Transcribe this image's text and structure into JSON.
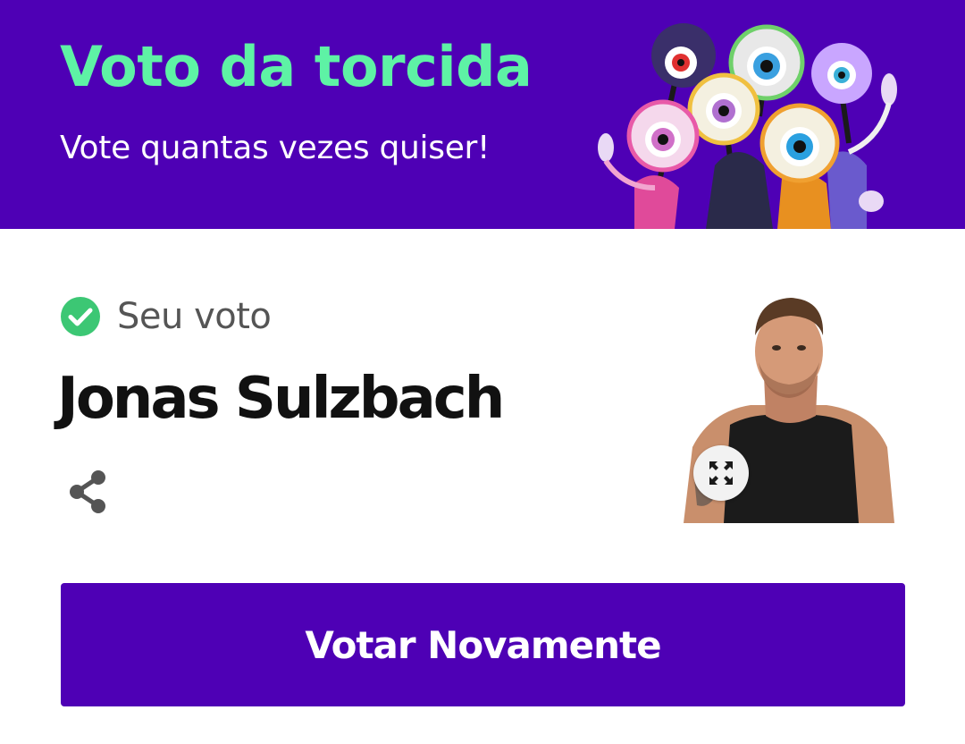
{
  "banner": {
    "title": "Voto da torcida",
    "subtitle": "Vote quantas vezes quiser!",
    "background_color": "#4e00b5",
    "title_color": "#5ef2a5",
    "mascots_icon": "bbb-eye-mascots-illustration"
  },
  "vote": {
    "status_icon": "check-circle-icon",
    "status_label": "Seu voto",
    "status_color": "#3cc774",
    "candidate_name": "Jonas Sulzbach",
    "share_icon": "share-icon",
    "photo_icon": "candidate-photo",
    "expand_icon": "expand-icon"
  },
  "actions": {
    "vote_again_label": "Votar Novamente",
    "button_color": "#4e00b5"
  }
}
